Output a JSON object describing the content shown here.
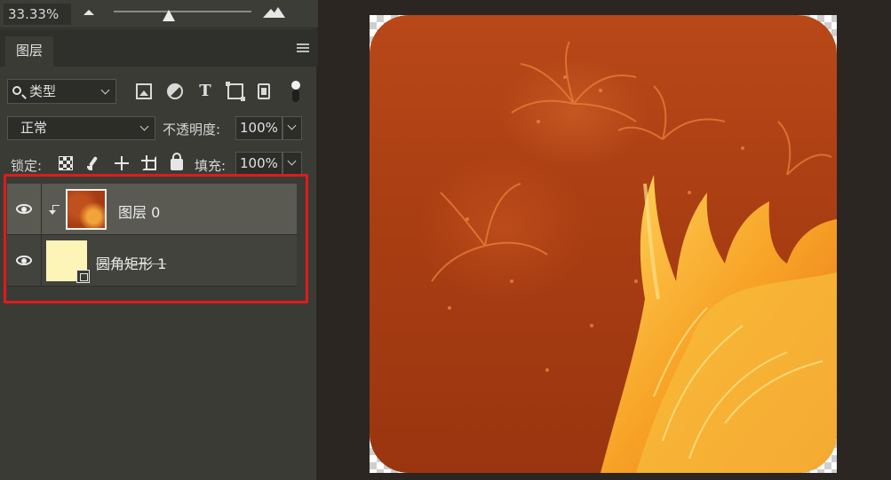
{
  "zoom": {
    "value": "33.33%"
  },
  "panel": {
    "tab_label": "图层",
    "filter": {
      "icon": "search-icon",
      "selected": "类型",
      "icons": [
        "pixel-layer-filter-icon",
        "adjustment-filter-icon",
        "type-filter-icon",
        "shape-filter-icon",
        "smart-object-filter-icon"
      ]
    },
    "blend_mode": "正常",
    "opacity_label": "不透明度:",
    "opacity_value": "100%",
    "lock_label": "锁定:",
    "fill_label": "填充:",
    "fill_value": "100%"
  },
  "layers": [
    {
      "name": "图层 0",
      "visible": true,
      "clipped": true,
      "selected": true
    },
    {
      "name": "圆角矩形 1",
      "visible": true,
      "clipped": false,
      "selected": false
    }
  ],
  "colors": {
    "highlight": "#e01b1b",
    "artwork_base": "#a83d12",
    "shape_fill": "#fdf4b8"
  }
}
